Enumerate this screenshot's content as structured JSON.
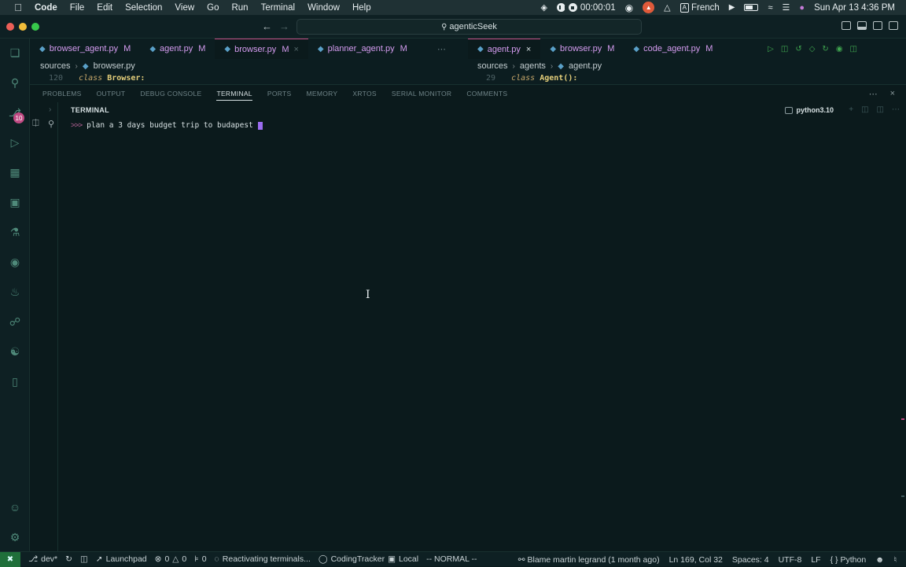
{
  "menubar": {
    "app": "Code",
    "items": [
      "File",
      "Edit",
      "Selection",
      "View",
      "Go",
      "Run",
      "Terminal",
      "Window",
      "Help"
    ],
    "timer": "00:00:01",
    "input_source": "French",
    "input_badge": "A",
    "datetime": "Sun Apr 13  4:36 PM"
  },
  "titlebar": {
    "command_center": "agenticSeek"
  },
  "left_group": {
    "tabs": [
      {
        "name": "browser_agent.py",
        "badge": "M"
      },
      {
        "name": "agent.py",
        "badge": "M"
      },
      {
        "name": "browser.py",
        "badge": "M"
      },
      {
        "name": "planner_agent.py",
        "badge": "M"
      }
    ],
    "breadcrumb": [
      "sources",
      "browser.py"
    ],
    "code_line_number": "120",
    "code_keyword": "class",
    "code_name": "Browser:"
  },
  "right_group": {
    "tabs": [
      {
        "name": "agent.py",
        "badge": "×"
      },
      {
        "name": "browser.py",
        "badge": "M"
      },
      {
        "name": "code_agent.py",
        "badge": "M"
      }
    ],
    "breadcrumb": [
      "sources",
      "agents",
      "agent.py"
    ],
    "code_line_number": "29",
    "code_keyword": "class",
    "code_name": "Agent():"
  },
  "activity_badge": "10",
  "panel": {
    "tabs": [
      "PROBLEMS",
      "OUTPUT",
      "DEBUG CONSOLE",
      "TERMINAL",
      "PORTS",
      "MEMORY",
      "XRTOS",
      "SERIAL MONITOR",
      "COMMENTS"
    ],
    "active_tab": "TERMINAL",
    "terminal_title": "TERMINAL",
    "terminal_profile": "python3.10",
    "prompt_arrows": ">>>",
    "prompt_text": "plan a 3 days budget trip to budapest"
  },
  "statusbar": {
    "branch": "dev*",
    "launchpad": "Launchpad",
    "errors": "0",
    "warnings": "0",
    "ports": "0",
    "task": "Reactivating terminals...",
    "tracker": "CodingTracker",
    "tracker_mode": "Local",
    "vim_mode": "-- NORMAL --",
    "blame": "Blame martin legrand (1 month ago)",
    "cursor": "Ln 169, Col 32",
    "spaces": "Spaces: 4",
    "encoding": "UTF-8",
    "eol": "LF",
    "language": "Python",
    "language_icon": "{ }"
  }
}
